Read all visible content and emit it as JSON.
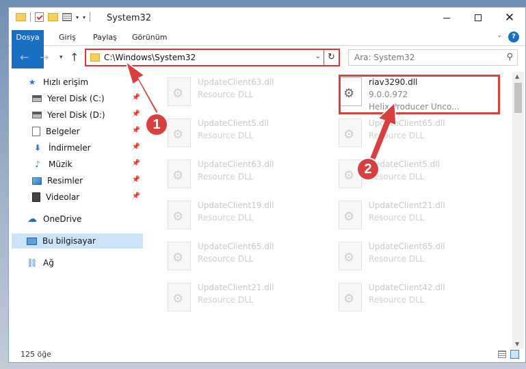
{
  "window": {
    "title": "System32",
    "controls": {
      "minimize": "—",
      "maximize": "□",
      "close": "✕"
    }
  },
  "ribbon": {
    "tabs": [
      "Dosya",
      "Giriş",
      "Paylaş",
      "Görünüm"
    ],
    "help": "?"
  },
  "navigation": {
    "address_path": "C:\\Windows\\System32",
    "search_placeholder": "Ara: System32",
    "back": "←",
    "forward": "→",
    "up": "↑",
    "refresh": "↻"
  },
  "sidebar": {
    "items": [
      {
        "label": "Hızlı erişim",
        "icon": "star-icon",
        "glyph": "★",
        "pinned": false
      },
      {
        "label": "Yerel Disk (C:)",
        "icon": "disk-icon",
        "glyph": "",
        "pinned": true
      },
      {
        "label": "Yerel Disk (D:)",
        "icon": "disk-icon",
        "glyph": "",
        "pinned": true
      },
      {
        "label": "Belgeler",
        "icon": "document-icon",
        "glyph": "",
        "pinned": true
      },
      {
        "label": "İndirmeler",
        "icon": "download-icon",
        "glyph": "⬇",
        "pinned": true
      },
      {
        "label": "Müzik",
        "icon": "music-icon",
        "glyph": "♪",
        "pinned": true
      },
      {
        "label": "Resimler",
        "icon": "image-icon",
        "glyph": "",
        "pinned": true
      },
      {
        "label": "Videolar",
        "icon": "video-icon",
        "glyph": "",
        "pinned": true
      },
      {
        "label": "OneDrive",
        "icon": "cloud-icon",
        "glyph": "☁",
        "pinned": false
      },
      {
        "label": "Bu bilgisayar",
        "icon": "computer-icon",
        "glyph": "",
        "pinned": false,
        "selected": true
      },
      {
        "label": "Ağ",
        "icon": "network-icon",
        "glyph": "⛓",
        "pinned": false
      }
    ]
  },
  "files": {
    "highlighted": {
      "name": "riav3290.dll",
      "version": "9.0.0.972",
      "description": "Helix Producer Unco..."
    },
    "left_column": [
      {
        "name": "UpdateClient63.dll",
        "type": "Resource DLL"
      },
      {
        "name": "UpdateClient5.dll",
        "type": "Resource DLL"
      },
      {
        "name": "UpdateClient63.dll",
        "type": "Resource DLL"
      },
      {
        "name": "UpdateClient19.dll",
        "type": "Resource DLL"
      },
      {
        "name": "UpdateClient65.dll",
        "type": "Resource DLL"
      },
      {
        "name": "UpdateClient21.dll",
        "type": "Resource DLL"
      }
    ],
    "right_column": [
      {
        "name": "UpdateClient65.dll",
        "type": "Resource DLL"
      },
      {
        "name": "UpdateClient5.dll",
        "type": "Resource DLL"
      },
      {
        "name": "UpdateClient21.dll",
        "type": "Resource DLL"
      },
      {
        "name": "UpdateClient65.dll",
        "type": "Resource DLL"
      },
      {
        "name": "UpdateClient42.dll",
        "type": "Resource DLL"
      }
    ]
  },
  "status": {
    "count": "125 öğe"
  },
  "annotations": {
    "step1": "1",
    "step2": "2",
    "color": "#d84040"
  }
}
